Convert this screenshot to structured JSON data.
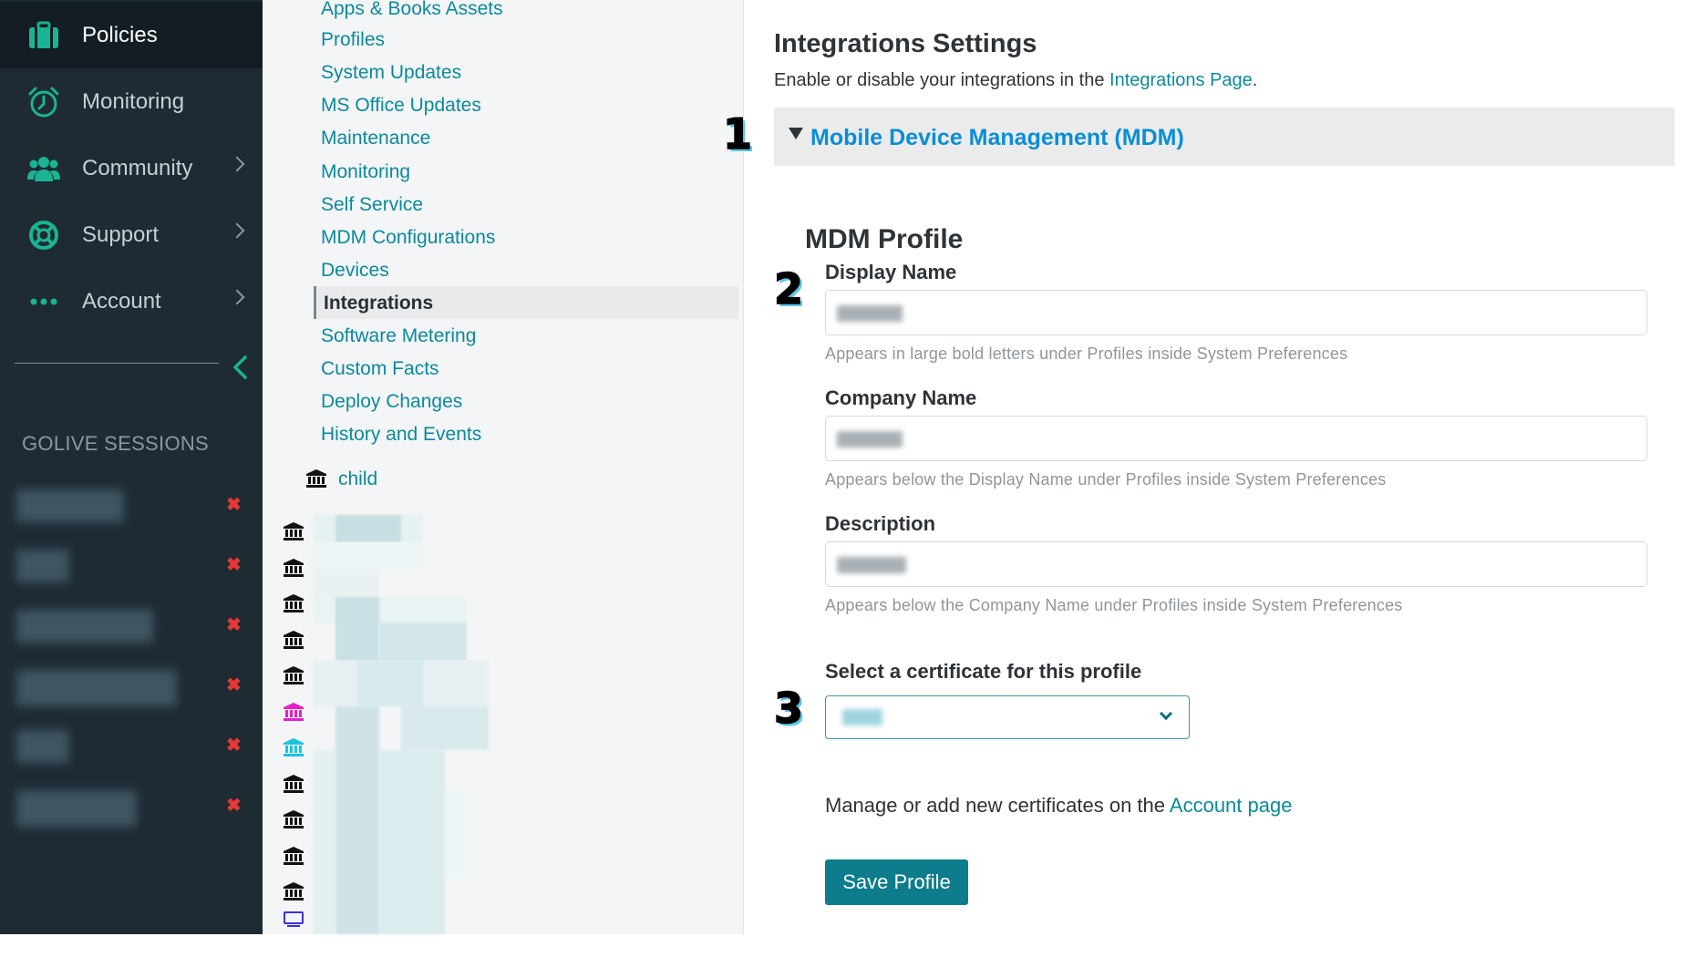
{
  "sidebar": {
    "items": [
      {
        "label": "Policies",
        "icon": "briefcase-icon"
      },
      {
        "label": "Monitoring",
        "icon": "alarm-clock-icon"
      },
      {
        "label": "Community",
        "icon": "people-icon"
      },
      {
        "label": "Support",
        "icon": "lifebuoy-icon"
      },
      {
        "label": "Account",
        "icon": "ellipsis-icon"
      }
    ],
    "sessions_title": "GOLIVE SESSIONS",
    "accent_color": "#1ab394",
    "remove_color": "#e53935"
  },
  "settings_nav": {
    "items": [
      "Apps & Books Assets",
      "Profiles",
      "System Updates",
      "MS Office Updates",
      "Maintenance",
      "Monitoring",
      "Self Service",
      "MDM Configurations",
      "Devices",
      "Integrations",
      "Software Metering",
      "Custom Facts",
      "Deploy Changes",
      "History and Events"
    ],
    "active": "Integrations",
    "child_label": "child"
  },
  "main": {
    "title": "Integrations Settings",
    "intro_prefix": "Enable or disable your integrations in the ",
    "intro_link": "Integrations Page",
    "intro_suffix": ".",
    "mdm_section": "Mobile Device Management (MDM)",
    "profile_title": "MDM Profile",
    "fields": {
      "display_name": {
        "label": "Display Name",
        "help": "Appears in large bold letters under Profiles inside System Preferences"
      },
      "company_name": {
        "label": "Company Name",
        "help": "Appears below the Display Name under Profiles inside System Preferences"
      },
      "description": {
        "label": "Description",
        "help": "Appears below the Company Name under Profiles inside System Preferences"
      }
    },
    "certificate_label": "Select a certificate for this profile",
    "manage_prefix": "Manage or add new certificates on the ",
    "manage_link": "Account page",
    "save_label": "Save Profile",
    "link_color": "#0a8a9c",
    "button_color": "#0d7c8c"
  },
  "callouts": [
    "1",
    "2",
    "3"
  ]
}
